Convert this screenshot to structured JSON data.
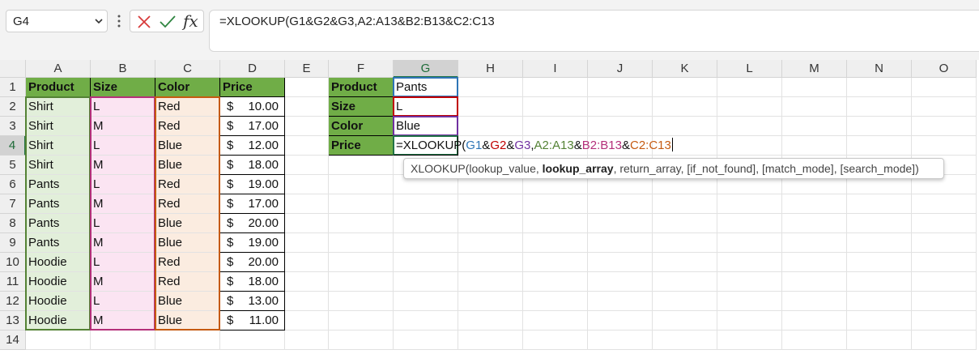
{
  "name_box": {
    "value": "G4"
  },
  "formula_bar": {
    "formula": "=XLOOKUP(G1&G2&G3,A2:A13&B2:B13&C2:C13"
  },
  "columns": [
    "A",
    "B",
    "C",
    "D",
    "E",
    "F",
    "G",
    "H",
    "I",
    "J",
    "K",
    "L",
    "M",
    "N",
    "O"
  ],
  "rows": [
    "1",
    "2",
    "3",
    "4",
    "5",
    "6",
    "7",
    "8",
    "9",
    "10",
    "11",
    "12",
    "13",
    "14"
  ],
  "selected_cell": {
    "column": "G",
    "row": "4"
  },
  "table": {
    "headers": [
      "Product",
      "Size",
      "Color",
      "Price"
    ],
    "currency": "$",
    "rows": [
      [
        "Shirt",
        "L",
        "Red",
        "10.00"
      ],
      [
        "Shirt",
        "M",
        "Red",
        "17.00"
      ],
      [
        "Shirt",
        "L",
        "Blue",
        "12.00"
      ],
      [
        "Shirt",
        "M",
        "Blue",
        "18.00"
      ],
      [
        "Pants",
        "L",
        "Red",
        "19.00"
      ],
      [
        "Pants",
        "M",
        "Red",
        "17.00"
      ],
      [
        "Pants",
        "L",
        "Blue",
        "20.00"
      ],
      [
        "Pants",
        "M",
        "Blue",
        "19.00"
      ],
      [
        "Hoodie",
        "L",
        "Red",
        "20.00"
      ],
      [
        "Hoodie",
        "M",
        "Red",
        "18.00"
      ],
      [
        "Hoodie",
        "L",
        "Blue",
        "13.00"
      ],
      [
        "Hoodie",
        "M",
        "Blue",
        "11.00"
      ]
    ]
  },
  "lookup": {
    "labels": [
      "Product",
      "Size",
      "Color",
      "Price"
    ],
    "values": [
      "Pants",
      "L",
      "Blue"
    ],
    "edit_formula": {
      "prefix": "=XLOOKUP(",
      "g1": "G1",
      "amp1": "&",
      "g2": "G2",
      "amp2": "&",
      "g3": "G3",
      "comma": ",",
      "rng_a": "A2:A13",
      "amp3": "&",
      "rng_b": "B2:B13",
      "amp4": "&",
      "rng_c": "C2:C13"
    }
  },
  "tooltip": {
    "func": "XLOOKUP(lookup_value, ",
    "active_arg": "lookup_array",
    "rest": ", return_array, [if_not_found], [match_mode], [search_mode])"
  },
  "colors": {
    "header_green": "#70ad47",
    "ref_blue": "#2e75b6",
    "ref_red": "#c00000",
    "ref_purple": "#7030a0",
    "range_green": "#548235",
    "range_pink": "#b4307a",
    "range_orange": "#c55a11"
  }
}
